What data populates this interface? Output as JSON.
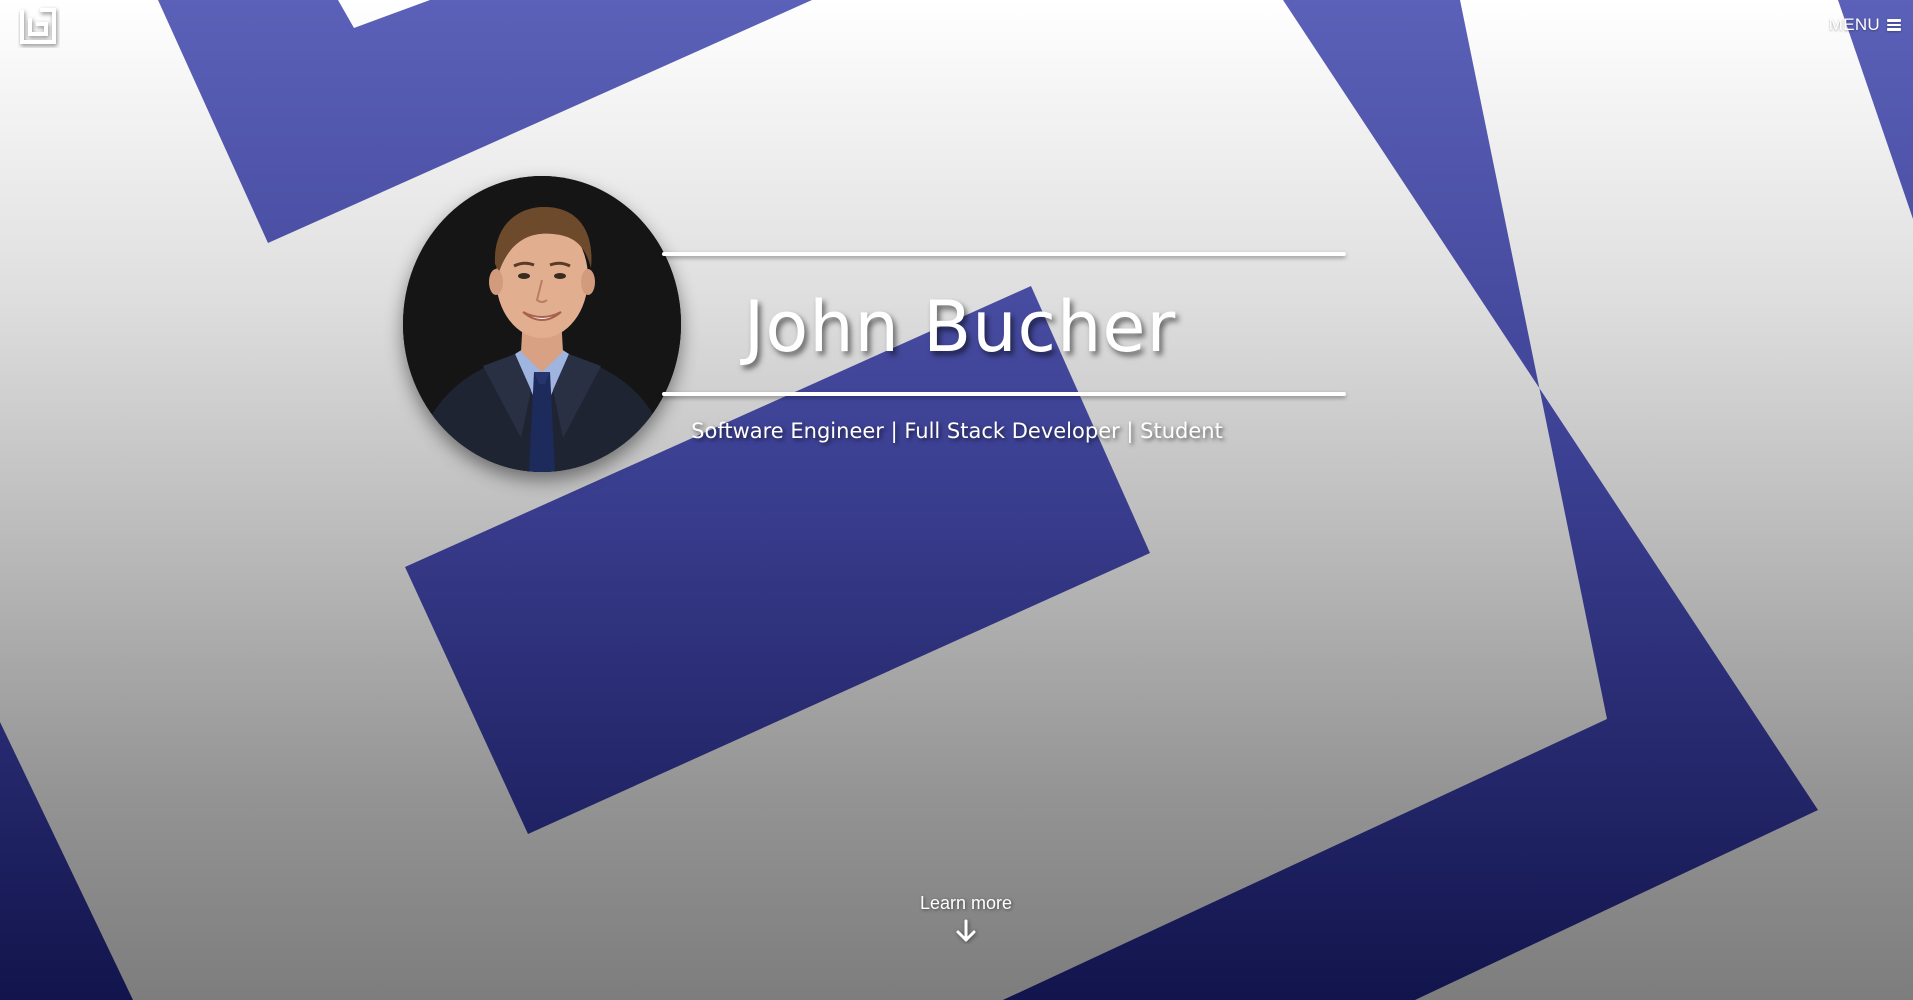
{
  "header": {
    "logo_icon": "bracket-b-logo-icon",
    "menu_label": "MENU",
    "menu_icon": "hamburger-menu-icon"
  },
  "hero": {
    "name": "John Bucher",
    "subtitle": "Software Engineer | Full Stack Developer | Student",
    "profile_photo": "profile-photo",
    "learn_more_label": "Learn more",
    "learn_more_icon": "arrow-down-icon"
  },
  "colors": {
    "accent_top": "#5a5fb6",
    "accent_bottom": "#13154f",
    "background_top": "#ffffff",
    "background_bottom": "#7d7d7d",
    "text": "#ffffff"
  }
}
